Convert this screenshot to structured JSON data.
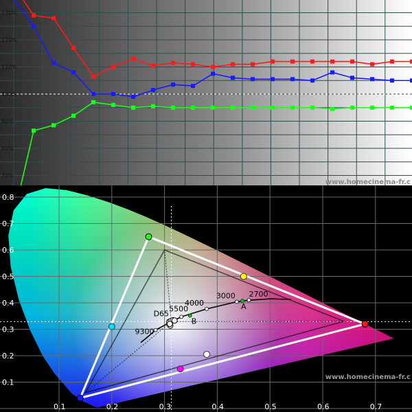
{
  "watermark": "www.homecinema-fr.c",
  "chart_data": [
    {
      "type": "line",
      "title": "",
      "xlabel": "",
      "ylabel": "",
      "ylim": [
        60,
        135
      ],
      "yticks": [
        "130%",
        "120%",
        "110%",
        "100%",
        "90%",
        "80%",
        "70%",
        "60%"
      ],
      "reference_line": 100,
      "x": [
        0,
        5,
        10,
        15,
        20,
        25,
        30,
        35,
        40,
        45,
        50,
        55,
        60,
        65,
        70,
        75,
        80,
        85,
        90,
        95,
        100
      ],
      "series": [
        {
          "color": "#ff1a1a",
          "values": [
            140,
            129,
            128,
            117,
            106.5,
            110,
            113,
            110.5,
            111.5,
            111,
            110,
            111,
            111,
            112,
            112,
            112,
            112,
            112,
            111,
            112,
            112
          ]
        },
        {
          "color": "#1a1aff",
          "values": [
            135,
            125,
            111.5,
            108,
            100,
            100,
            99,
            101.5,
            103.5,
            103,
            107.5,
            106,
            105.5,
            105.5,
            105.5,
            105,
            108,
            106,
            105.5,
            105,
            105
          ]
        },
        {
          "color": "#1aff1a",
          "values": [
            55,
            86.5,
            88.5,
            92,
            97,
            96,
            95,
            95.5,
            95,
            95,
            95,
            95,
            95,
            95,
            95,
            95,
            94.5,
            95,
            95,
            95,
            95
          ]
        }
      ]
    },
    {
      "type": "scatter",
      "title": "",
      "xlim": [
        0.05,
        0.77
      ],
      "ylim": [
        0,
        0.85
      ],
      "xticks": [
        "0.1",
        "0.2",
        "0.3",
        "0.4",
        "0.5",
        "0.6",
        "0.7"
      ],
      "yticks": [
        "0.8",
        "0.7",
        "0.6",
        "0.5",
        "0.4",
        "0.3",
        "0.2",
        "0.1"
      ],
      "reference_gamut": [
        [
          0.64,
          0.33
        ],
        [
          0.3,
          0.6
        ],
        [
          0.15,
          0.06
        ]
      ],
      "measured_gamut": [
        [
          0.68,
          0.32
        ],
        [
          0.27,
          0.65
        ],
        [
          0.14,
          0.04
        ]
      ],
      "measured_secondaries": [
        {
          "color": "#00e0ff",
          "x": 0.2,
          "y": 0.31
        },
        {
          "color": "#ffff00",
          "x": 0.45,
          "y": 0.5
        },
        {
          "color": "#ff00ff",
          "x": 0.33,
          "y": 0.15
        }
      ],
      "white_point": {
        "x": 0.313,
        "y": 0.329,
        "label": "D65"
      },
      "cct_labels": [
        "9300",
        "5500",
        "4000",
        "3000",
        "2700"
      ],
      "illuminants": [
        "A",
        "B"
      ]
    }
  ]
}
